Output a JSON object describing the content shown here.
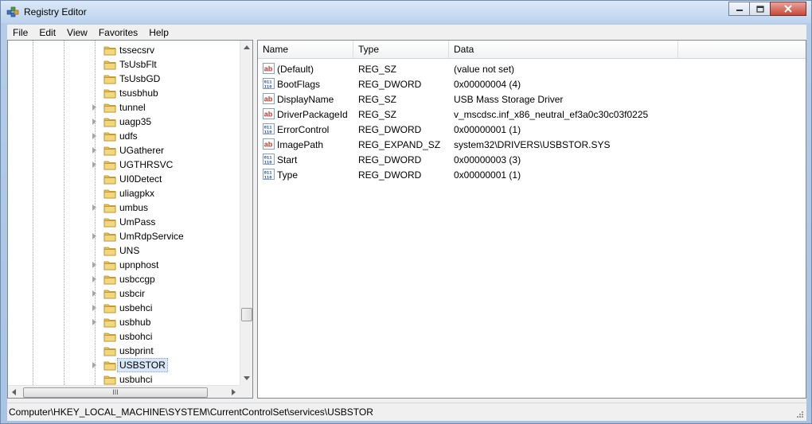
{
  "window": {
    "title": "Registry Editor",
    "icon": "registry-editor-icon"
  },
  "window_buttons": {
    "minimize_icon": "minimize-icon",
    "maximize_icon": "maximize-icon",
    "close_icon": "close-icon"
  },
  "menu": [
    {
      "label": "File"
    },
    {
      "label": "Edit"
    },
    {
      "label": "View"
    },
    {
      "label": "Favorites"
    },
    {
      "label": "Help"
    }
  ],
  "tree": {
    "items": [
      {
        "label": "tssecsrv",
        "expandable": false
      },
      {
        "label": "TsUsbFlt",
        "expandable": false
      },
      {
        "label": "TsUsbGD",
        "expandable": false
      },
      {
        "label": "tsusbhub",
        "expandable": false
      },
      {
        "label": "tunnel",
        "expandable": true
      },
      {
        "label": "uagp35",
        "expandable": true
      },
      {
        "label": "udfs",
        "expandable": true
      },
      {
        "label": "UGatherer",
        "expandable": true
      },
      {
        "label": "UGTHRSVC",
        "expandable": true
      },
      {
        "label": "UI0Detect",
        "expandable": false
      },
      {
        "label": "uliagpkx",
        "expandable": false
      },
      {
        "label": "umbus",
        "expandable": true
      },
      {
        "label": "UmPass",
        "expandable": false
      },
      {
        "label": "UmRdpService",
        "expandable": true
      },
      {
        "label": "UNS",
        "expandable": false
      },
      {
        "label": "upnphost",
        "expandable": true
      },
      {
        "label": "usbccgp",
        "expandable": true
      },
      {
        "label": "usbcir",
        "expandable": true
      },
      {
        "label": "usbehci",
        "expandable": true
      },
      {
        "label": "usbhub",
        "expandable": true
      },
      {
        "label": "usbohci",
        "expandable": false
      },
      {
        "label": "usbprint",
        "expandable": false
      },
      {
        "label": "USBSTOR",
        "expandable": true,
        "selected": true
      },
      {
        "label": "usbuhci",
        "expandable": false
      }
    ],
    "folder_icon": "folder-icon",
    "highlight_color": "#d42a2a",
    "hscroll_glyph": "III"
  },
  "values": {
    "columns": [
      "Name",
      "Type",
      "Data"
    ],
    "rows": [
      {
        "name": "(Default)",
        "type": "REG_SZ",
        "data": "(value not set)",
        "icon": "string-value-icon"
      },
      {
        "name": "BootFlags",
        "type": "REG_DWORD",
        "data": "0x00000004 (4)",
        "icon": "binary-value-icon"
      },
      {
        "name": "DisplayName",
        "type": "REG_SZ",
        "data": "USB Mass Storage Driver",
        "icon": "string-value-icon"
      },
      {
        "name": "DriverPackageId",
        "type": "REG_SZ",
        "data": "v_mscdsc.inf_x86_neutral_ef3a0c30c03f0225",
        "icon": "string-value-icon"
      },
      {
        "name": "ErrorControl",
        "type": "REG_DWORD",
        "data": "0x00000001 (1)",
        "icon": "binary-value-icon"
      },
      {
        "name": "ImagePath",
        "type": "REG_EXPAND_SZ",
        "data": "system32\\DRIVERS\\USBSTOR.SYS",
        "icon": "string-value-icon"
      },
      {
        "name": "Start",
        "type": "REG_DWORD",
        "data": "0x00000003 (3)",
        "icon": "binary-value-icon"
      },
      {
        "name": "Type",
        "type": "REG_DWORD",
        "data": "0x00000001 (1)",
        "icon": "binary-value-icon"
      }
    ]
  },
  "status": {
    "path": "Computer\\HKEY_LOCAL_MACHINE\\SYSTEM\\CurrentControlSet\\services\\USBSTOR"
  }
}
